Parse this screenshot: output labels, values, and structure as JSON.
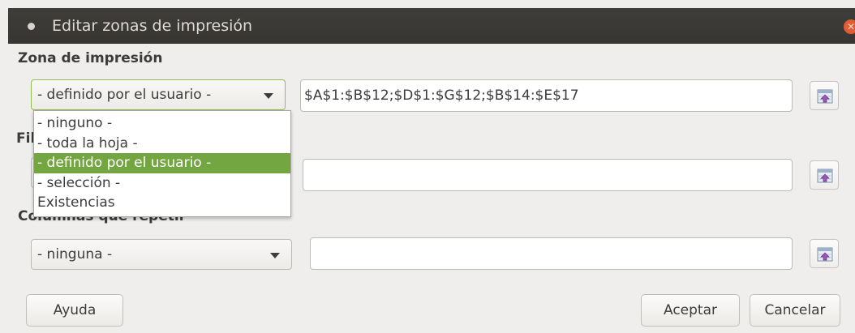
{
  "window": {
    "title": "Editar zonas de impresión"
  },
  "print_range": {
    "label": "Zona de impresión",
    "combo_value": "- definido por el usuario -",
    "field_value": "$A$1:$B$12;$D$1:$G$12;$B$14:$E$17"
  },
  "rows_repeat": {
    "label_partial": "Fil",
    "field_value": ""
  },
  "columns_repeat": {
    "label": "Columnas que repetir",
    "combo_value": "- ninguna -",
    "field_value": ""
  },
  "dropdown": {
    "options": [
      "- ninguno -",
      "- toda la hoja -",
      "- definido por el usuario -",
      "- selección -",
      "Existencias"
    ],
    "selected_index": 2
  },
  "buttons": {
    "help": "Ayuda",
    "ok": "Aceptar",
    "cancel": "Cancelar"
  },
  "icons": {
    "title": "window-menu-dot-icon",
    "close": "close-icon",
    "shrink": "shrink-range-icon"
  },
  "colors": {
    "titlebar": "#3e3d39",
    "close": "#e35d34",
    "selection": "#73a541",
    "focus_border": "#8fbd4f"
  }
}
